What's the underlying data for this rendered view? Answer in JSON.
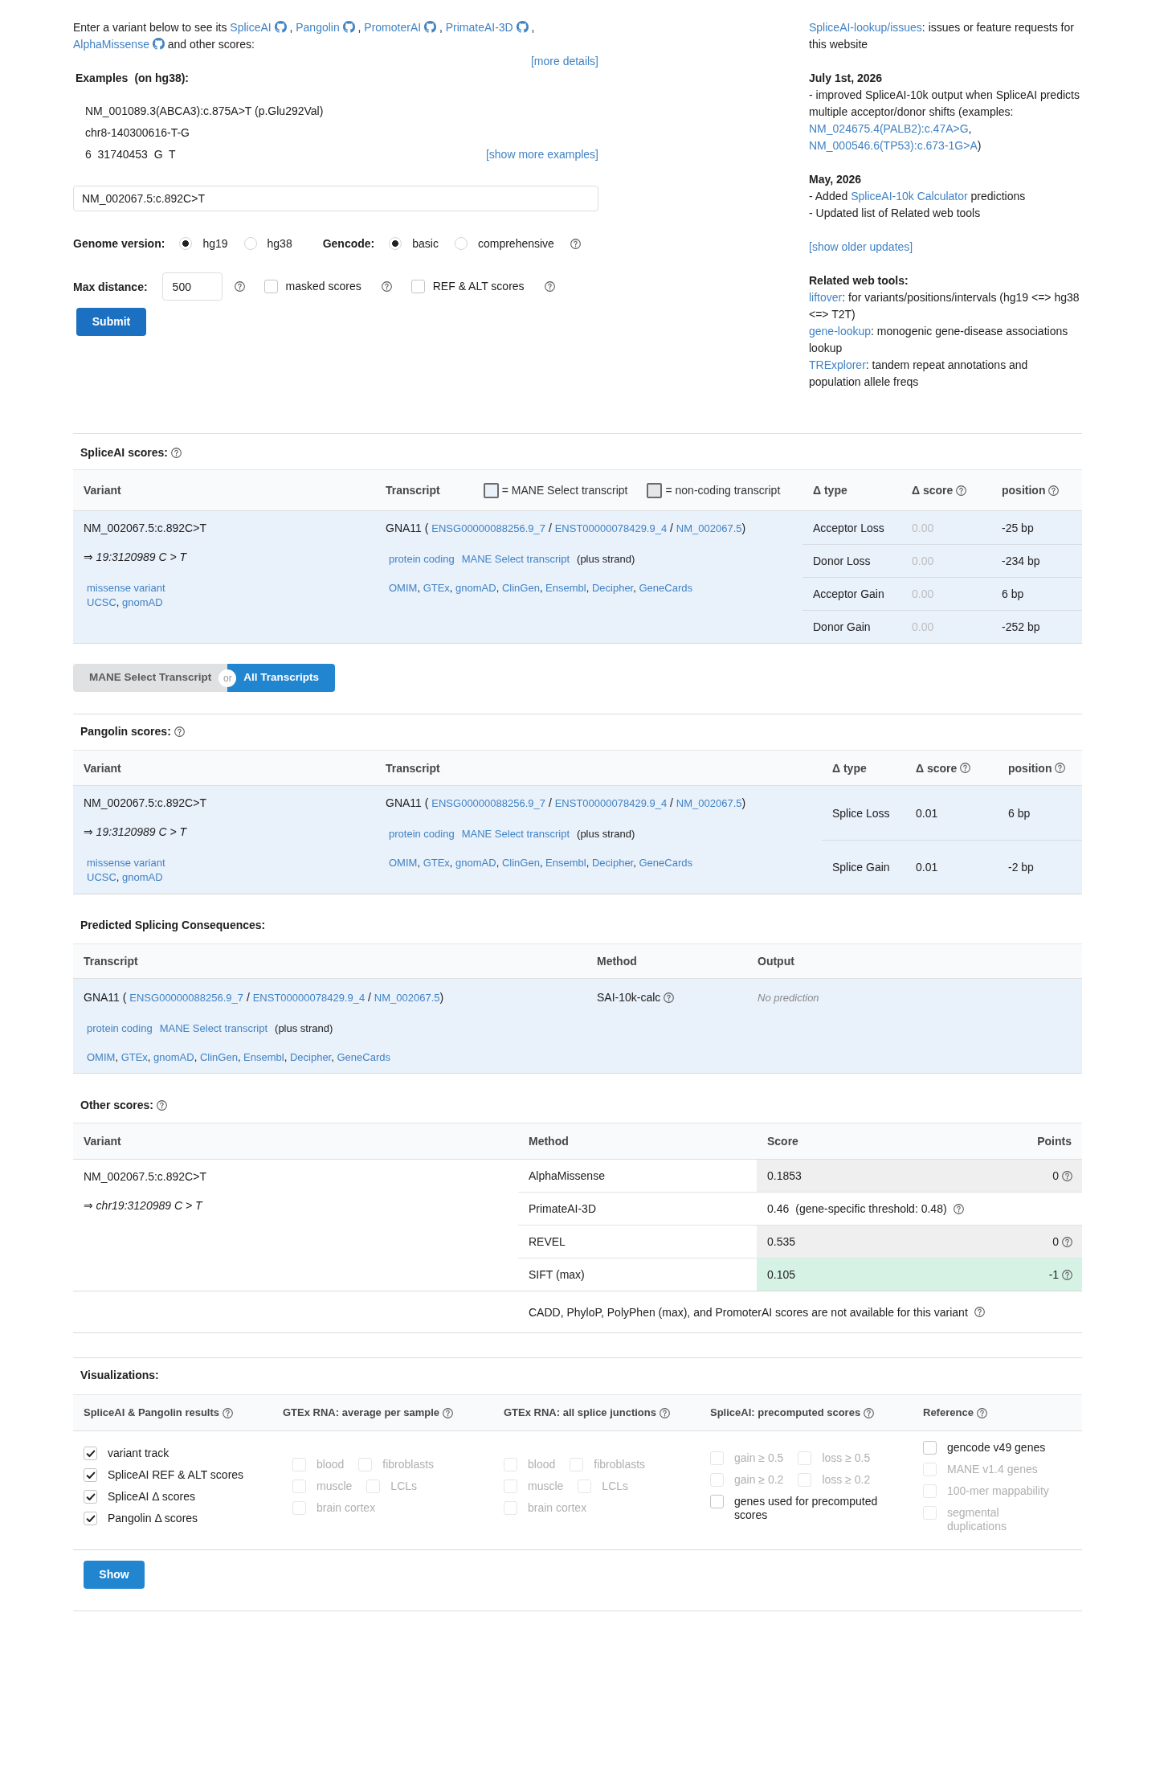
{
  "intro": {
    "lead": "Enter a variant below to see its",
    "tools": [
      {
        "label": "SpliceAI",
        "after": ","
      },
      {
        "label": "Pangolin",
        "after": ","
      },
      {
        "label": "PromoterAI",
        "after": ","
      },
      {
        "label": "PrimateAI-3D",
        "after": ","
      },
      {
        "label": "AlphaMissense"
      }
    ],
    "tail": "and other scores:",
    "more": "[more details]"
  },
  "examples": {
    "title": "Examples",
    "note": "(on hg38):",
    "items": [
      "NM_001089.3(ABCA3):c.875A>T (p.Glu292Val)",
      "chr8-140300616-T-G",
      "6  31740453  G  T"
    ],
    "more": "[show more examples]"
  },
  "variant_input": {
    "value": "NM_002067.5:c.892C>T"
  },
  "genome": {
    "label": "Genome version:",
    "options": [
      {
        "label": "hg19",
        "selected": true
      },
      {
        "label": "hg38",
        "selected": false
      }
    ]
  },
  "gencode": {
    "label": "Gencode:",
    "options": [
      {
        "label": "basic",
        "selected": true
      },
      {
        "label": "comprehensive",
        "selected": false
      }
    ],
    "help": true
  },
  "max_distance": {
    "label": "Max distance:",
    "value": "500",
    "help": true
  },
  "score_options": [
    {
      "label": "masked scores",
      "checked": false,
      "help": true
    },
    {
      "label": "REF & ALT scores",
      "checked": false,
      "help": true
    }
  ],
  "submit": "Submit",
  "news": {
    "issues": [
      {
        "kind": "link",
        "text": "SpliceAI-lookup/issues"
      },
      {
        "kind": "text",
        "text": ": issues or feature requests for this website"
      }
    ],
    "updates": [
      {
        "date": "July 1st, 2026",
        "lines": [
          [
            {
              "kind": "text",
              "text": "- improved SpliceAI-10k output when SpliceAI predicts multiple acceptor/donor shifts (examples: "
            },
            {
              "kind": "link",
              "text": "NM_024675.4(PALB2):c.47A>G"
            },
            {
              "kind": "text",
              "text": ", "
            },
            {
              "kind": "link",
              "text": "NM_000546.6(TP53):c.673-1G>A"
            },
            {
              "kind": "text",
              "text": ")"
            }
          ]
        ]
      },
      {
        "date": "May, 2026",
        "lines": [
          [
            {
              "kind": "text",
              "text": "- Added "
            },
            {
              "kind": "link",
              "text": "SpliceAI-10k Calculator"
            },
            {
              "kind": "text",
              "text": " predictions"
            }
          ],
          [
            {
              "kind": "text",
              "text": "- Updated list of Related web tools"
            }
          ]
        ]
      }
    ],
    "older": "[show older updates]",
    "tools_title": "Related web tools:",
    "tools": [
      [
        {
          "kind": "link",
          "text": "liftover"
        },
        {
          "kind": "text",
          "text": ": for variants/positions/intervals (hg19 <=> hg38 <=> T2T)"
        }
      ],
      [
        {
          "kind": "link",
          "text": "gene-lookup"
        },
        {
          "kind": "text",
          "text": ": monogenic gene-disease associations lookup"
        }
      ],
      [
        {
          "kind": "link",
          "text": "TRExplorer"
        },
        {
          "kind": "text",
          "text": ": tandem repeat annotations and population allele freqs"
        }
      ]
    ]
  },
  "spliceai": {
    "title": "SpliceAI scores:",
    "help": true,
    "columns": [
      {
        "label": "Variant"
      },
      {
        "label": "Transcript",
        "legend": [
          {
            "label": "= MANE Select transcript",
            "color": "#e9f1fb"
          },
          {
            "label": "= non-coding transcript",
            "color": "#e6e6e6"
          }
        ]
      },
      {
        "label": "Δ type"
      },
      {
        "label": "Δ score",
        "help": true
      },
      {
        "label": "position",
        "help": true
      }
    ],
    "rows": [
      {
        "mane_select": true,
        "variant": {
          "id": "NM_002067.5:c.892C>T",
          "position": "⇒ 19:3120989 C > T",
          "consequence": "missense variant",
          "links": [
            {
              "kind": "link",
              "text": "UCSC"
            },
            {
              "kind": "text",
              "text": ", "
            },
            {
              "kind": "link",
              "text": "gnomAD"
            }
          ]
        },
        "transcript": {
          "ids": [
            {
              "kind": "text",
              "text": "GNA11 ( "
            },
            {
              "kind": "link",
              "text": "ENSG00000088256.9_7"
            },
            {
              "kind": "text",
              "text": " / "
            },
            {
              "kind": "link",
              "text": "ENST00000078429.9_4"
            },
            {
              "kind": "text",
              "text": " / "
            },
            {
              "kind": "link",
              "text": "NM_002067.5"
            },
            {
              "kind": "text",
              "text": ")"
            }
          ],
          "tags": [
            {
              "kind": "link",
              "text": "protein coding"
            },
            {
              "kind": "link",
              "text": "MANE Select transcript"
            },
            {
              "kind": "text",
              "text": "(plus strand)"
            }
          ],
          "resources": [
            {
              "kind": "link",
              "text": "OMIM"
            },
            {
              "kind": "text",
              "text": ", "
            },
            {
              "kind": "link",
              "text": "GTEx"
            },
            {
              "kind": "text",
              "text": ", "
            },
            {
              "kind": "link",
              "text": "gnomAD"
            },
            {
              "kind": "text",
              "text": ", "
            },
            {
              "kind": "link",
              "text": "ClinGen"
            },
            {
              "kind": "text",
              "text": ", "
            },
            {
              "kind": "link",
              "text": "Ensembl"
            },
            {
              "kind": "text",
              "text": ", "
            },
            {
              "kind": "link",
              "text": "Decipher"
            },
            {
              "kind": "text",
              "text": ", "
            },
            {
              "kind": "link",
              "text": "GeneCards"
            }
          ]
        },
        "scores": [
          {
            "type": "Acceptor Loss",
            "score": "0.00",
            "dimmed": true,
            "position": "-25 bp"
          },
          {
            "type": "Donor Loss",
            "score": "0.00",
            "dimmed": true,
            "position": "-234 bp"
          },
          {
            "type": "Acceptor Gain",
            "score": "0.00",
            "dimmed": true,
            "position": "6 bp"
          },
          {
            "type": "Donor Gain",
            "score": "0.00",
            "dimmed": true,
            "position": "-252 bp"
          }
        ]
      }
    ]
  },
  "transcript_toggle": {
    "options": [
      {
        "label": "MANE Select Transcript",
        "selected": false
      },
      {
        "label": "All Transcripts",
        "selected": true
      }
    ],
    "divider": "or"
  },
  "pangolin": {
    "title": "Pangolin scores:",
    "help": true,
    "columns": [
      {
        "label": "Variant"
      },
      {
        "label": "Transcript"
      },
      {
        "label": "Δ type"
      },
      {
        "label": "Δ score",
        "help": true
      },
      {
        "label": "position",
        "help": true
      }
    ],
    "rows": [
      {
        "mane_select": true,
        "variant": {
          "id": "NM_002067.5:c.892C>T",
          "position": "⇒ 19:3120989 C > T",
          "consequence": "missense variant",
          "links": [
            {
              "kind": "link",
              "text": "UCSC"
            },
            {
              "kind": "text",
              "text": ", "
            },
            {
              "kind": "link",
              "text": "gnomAD"
            }
          ]
        },
        "transcript": {
          "ids": [
            {
              "kind": "text",
              "text": "GNA11 ( "
            },
            {
              "kind": "link",
              "text": "ENSG00000088256.9_7"
            },
            {
              "kind": "text",
              "text": " / "
            },
            {
              "kind": "link",
              "text": "ENST00000078429.9_4"
            },
            {
              "kind": "text",
              "text": " / "
            },
            {
              "kind": "link",
              "text": "NM_002067.5"
            },
            {
              "kind": "text",
              "text": ")"
            }
          ],
          "tags": [
            {
              "kind": "link",
              "text": "protein coding"
            },
            {
              "kind": "link",
              "text": "MANE Select transcript"
            },
            {
              "kind": "text",
              "text": "(plus strand)"
            }
          ],
          "resources": [
            {
              "kind": "link",
              "text": "OMIM"
            },
            {
              "kind": "text",
              "text": ", "
            },
            {
              "kind": "link",
              "text": "GTEx"
            },
            {
              "kind": "text",
              "text": ", "
            },
            {
              "kind": "link",
              "text": "gnomAD"
            },
            {
              "kind": "text",
              "text": ", "
            },
            {
              "kind": "link",
              "text": "ClinGen"
            },
            {
              "kind": "text",
              "text": ", "
            },
            {
              "kind": "link",
              "text": "Ensembl"
            },
            {
              "kind": "text",
              "text": ", "
            },
            {
              "kind": "link",
              "text": "Decipher"
            },
            {
              "kind": "text",
              "text": ", "
            },
            {
              "kind": "link",
              "text": "GeneCards"
            }
          ]
        },
        "scores": [
          {
            "type": "Splice Loss",
            "score": "0.01",
            "dimmed": false,
            "position": "6 bp"
          },
          {
            "type": "Splice Gain",
            "score": "0.01",
            "dimmed": false,
            "position": "-2 bp"
          }
        ]
      }
    ]
  },
  "consequences": {
    "title": "Predicted Splicing Consequences:",
    "columns": [
      {
        "label": "Transcript"
      },
      {
        "label": "Method"
      },
      {
        "label": "Output"
      }
    ],
    "rows": [
      {
        "mane_select": true,
        "transcript": {
          "ids": [
            {
              "kind": "text",
              "text": "GNA11 ( "
            },
            {
              "kind": "link",
              "text": "ENSG00000088256.9_7"
            },
            {
              "kind": "text",
              "text": " / "
            },
            {
              "kind": "link",
              "text": "ENST00000078429.9_4"
            },
            {
              "kind": "text",
              "text": " / "
            },
            {
              "kind": "link",
              "text": "NM_002067.5"
            },
            {
              "kind": "text",
              "text": ")"
            }
          ],
          "tags": [
            {
              "kind": "link",
              "text": "protein coding"
            },
            {
              "kind": "link",
              "text": "MANE Select transcript"
            },
            {
              "kind": "text",
              "text": "(plus strand)"
            }
          ],
          "resources": [
            {
              "kind": "link",
              "text": "OMIM"
            },
            {
              "kind": "text",
              "text": ", "
            },
            {
              "kind": "link",
              "text": "GTEx"
            },
            {
              "kind": "text",
              "text": ", "
            },
            {
              "kind": "link",
              "text": "gnomAD"
            },
            {
              "kind": "text",
              "text": ", "
            },
            {
              "kind": "link",
              "text": "ClinGen"
            },
            {
              "kind": "text",
              "text": ", "
            },
            {
              "kind": "link",
              "text": "Ensembl"
            },
            {
              "kind": "text",
              "text": ", "
            },
            {
              "kind": "link",
              "text": "Decipher"
            },
            {
              "kind": "text",
              "text": ", "
            },
            {
              "kind": "link",
              "text": "GeneCards"
            }
          ]
        },
        "method": "SAI-10k-calc",
        "method_help": true,
        "output": "No prediction"
      }
    ]
  },
  "other_scores": {
    "title": "Other scores:",
    "help": true,
    "columns": [
      {
        "label": "Variant"
      },
      {
        "label": "Method"
      },
      {
        "label": "Score"
      },
      {
        "label": "Points"
      }
    ],
    "variant": {
      "id": "NM_002067.5:c.892C>T",
      "position": "⇒ chr19:3120989 C > T"
    },
    "rows": [
      {
        "method": "AlphaMissense",
        "score": "0.1853",
        "points": "0",
        "color": "#efefef",
        "help": true
      },
      {
        "method": "PrimateAI-3D",
        "score": "0.46",
        "threshold": "(gene-specific threshold: 0.48)",
        "help": true
      },
      {
        "method": "REVEL",
        "score": "0.535",
        "points": "0",
        "color": "#efefef",
        "help": true
      },
      {
        "method": "SIFT (max)",
        "score": "0.105",
        "points": "-1",
        "color": "#d6f2e4",
        "help": true
      }
    ],
    "note": "CADD, PhyloP, PolyPhen (max), and PromoterAI scores are not available for this variant",
    "note_help": true
  },
  "visualizations": {
    "title": "Visualizations:",
    "groups": [
      {
        "title": "SpliceAI & Pangolin results",
        "help": true,
        "lines": [
          [
            {
              "label": "variant track",
              "checked": true,
              "disabled": false
            }
          ],
          [
            {
              "label": "SpliceAI REF & ALT scores",
              "checked": true,
              "disabled": false
            }
          ],
          [
            {
              "label": "SpliceAI Δ scores",
              "checked": true,
              "disabled": false
            }
          ],
          [
            {
              "label": "Pangolin Δ scores",
              "checked": true,
              "disabled": false
            }
          ]
        ]
      },
      {
        "title": "GTEx RNA: average per sample",
        "help": true,
        "lines": [
          [
            {
              "label": "blood",
              "checked": false,
              "disabled": true
            },
            {
              "label": "fibroblasts",
              "checked": false,
              "disabled": true
            }
          ],
          [
            {
              "label": "muscle",
              "checked": false,
              "disabled": true
            },
            {
              "label": "LCLs",
              "checked": false,
              "disabled": true
            }
          ],
          [
            {
              "label": "brain cortex",
              "checked": false,
              "disabled": true
            }
          ]
        ]
      },
      {
        "title": "GTEx RNA: all splice junctions",
        "help": true,
        "lines": [
          [
            {
              "label": "blood",
              "checked": false,
              "disabled": true
            },
            {
              "label": "fibroblasts",
              "checked": false,
              "disabled": true
            }
          ],
          [
            {
              "label": "muscle",
              "checked": false,
              "disabled": true
            },
            {
              "label": "LCLs",
              "checked": false,
              "disabled": true
            }
          ],
          [
            {
              "label": "brain cortex",
              "checked": false,
              "disabled": true
            }
          ]
        ]
      },
      {
        "title": "SpliceAI: precomputed scores",
        "help": true,
        "lines": [
          [
            {
              "label": "gain ≥ 0.5",
              "checked": false,
              "disabled": true
            },
            {
              "label": "loss ≥ 0.5",
              "checked": false,
              "disabled": true
            }
          ],
          [
            {
              "label": "gain ≥ 0.2",
              "checked": false,
              "disabled": true
            },
            {
              "label": "loss ≥ 0.2",
              "checked": false,
              "disabled": true
            }
          ],
          [
            {
              "label": "genes used for precomputed scores",
              "checked": false,
              "disabled": false
            }
          ]
        ]
      },
      {
        "title": "Reference",
        "help": true,
        "lines": [
          [
            {
              "label": "gencode v49 genes",
              "checked": false,
              "disabled": false
            }
          ],
          [
            {
              "label": "MANE v1.4 genes",
              "checked": false,
              "disabled": true
            }
          ],
          [
            {
              "label": "100-mer mappability",
              "checked": false,
              "disabled": true
            }
          ],
          [
            {
              "label": "segmental duplications",
              "checked": false,
              "disabled": true
            }
          ]
        ]
      }
    ],
    "show": "Show"
  }
}
